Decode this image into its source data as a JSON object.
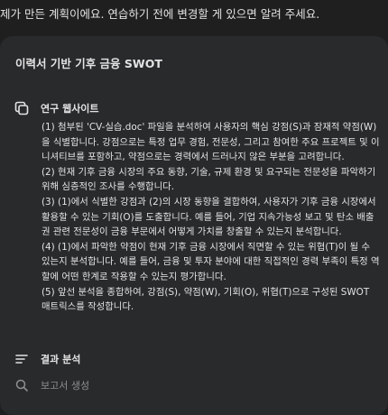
{
  "intro_text": "제가 만든 계획이에요. 연습하기 전에 변경할 게 있으면 알려 주세요.",
  "plan": {
    "title": "이력서 기반 기후 금융 SWOT",
    "steps": [
      {
        "label": "연구 웹사이트",
        "icon": "research-web-icon"
      },
      {
        "label": "결과 분석",
        "icon": "analyze-results-icon"
      },
      {
        "label": "보고서 생성",
        "icon": "generate-report-icon"
      }
    ],
    "research_items": [
      "(1) 첨부된 'CV-실습.doc' 파일을 분석하여 사용자의 핵심 강점(S)과 잠재적 약점(W)을 식별합니다. 강점으로는 특정 업무 경험, 전문성, 그리고 참여한 주요 프로젝트 및 이니셔티브를 포함하고, 약점으로는 경력에서 드러나지 않은 부분을 고려합니다.",
      "(2) 현재 기후 금융 시장의 주요 동향, 기술, 규제 환경 및 요구되는 전문성을 파악하기 위해 심층적인 조사를 수행합니다.",
      "(3) (1)에서 식별한 강점과 (2)의 시장 동향을 결합하여, 사용자가 기후 금융 시장에서 활용할 수 있는 기회(O)를 도출합니다. 예를 들어, 기업 지속가능성 보고 및 탄소 배출권 관련 전문성이 금융 부문에서 어떻게 가치를 창출할 수 있는지 분석합니다.",
      "(4) (1)에서 파악한 약점이 현재 기후 금융 시장에서 직면할 수 있는 위협(T)이 될 수 있는지 분석합니다. 예를 들어, 금융 및 투자 분야에 대한 직접적인 경력 부족이 특정 역할에 어떤 한계로 작용할 수 있는지 평가합니다.",
      "(5) 앞선 분석을 종합하여, 강점(S), 약점(W), 기회(O), 위협(T)으로 구성된 SWOT 매트릭스를 작성합니다."
    ]
  }
}
